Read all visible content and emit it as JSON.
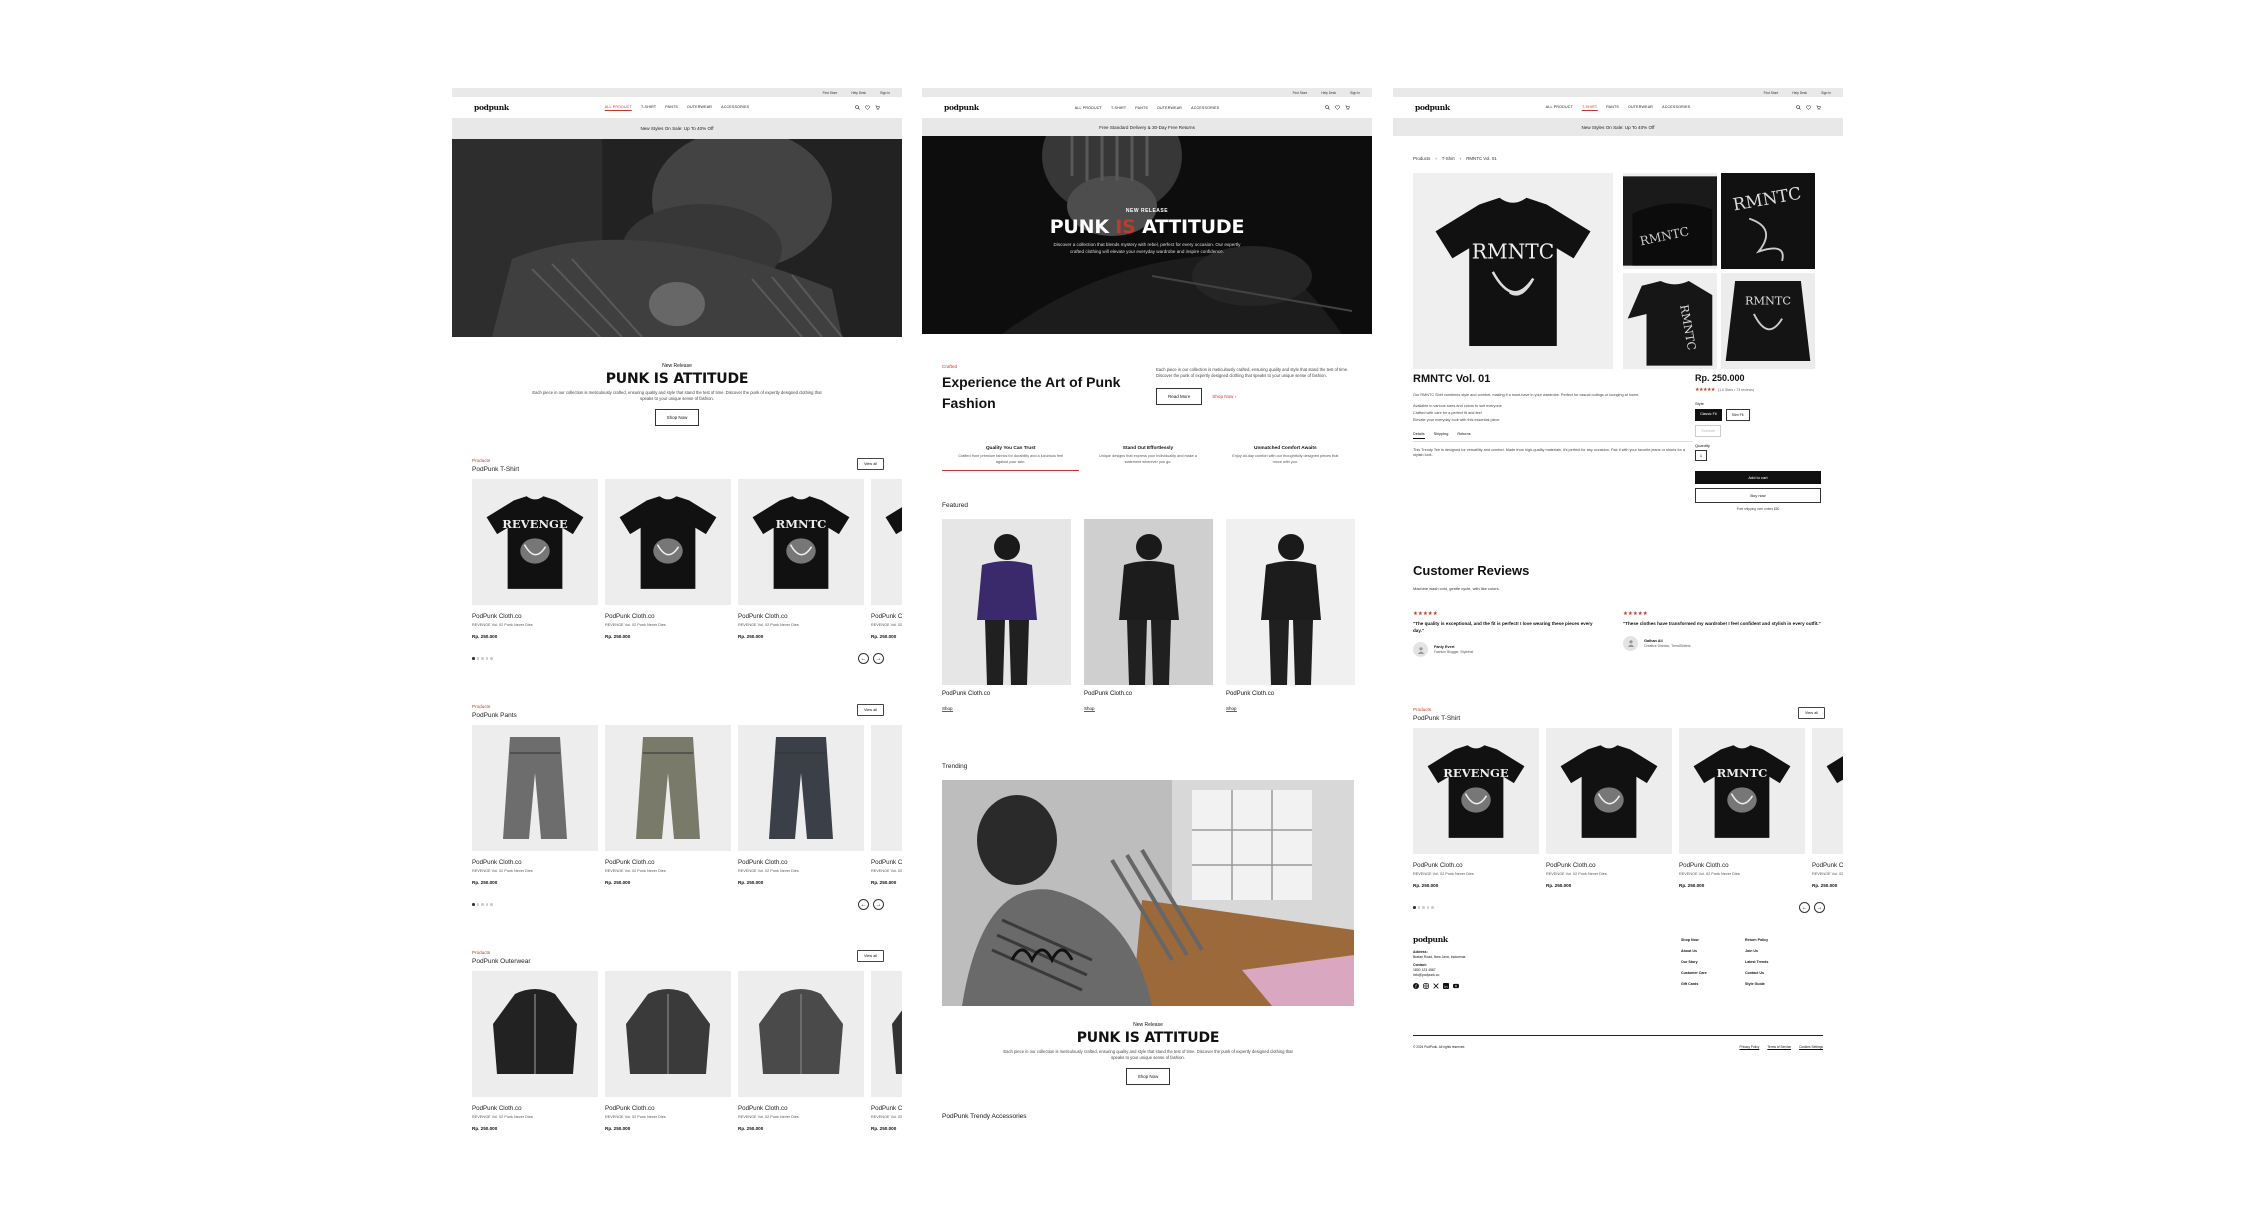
{
  "common": {
    "util": [
      "Find Store",
      "Help Desk",
      "Sign In"
    ],
    "logo": "podpunk",
    "menu": [
      "ALL PRODUCT",
      "T-SHIRT",
      "PANTS",
      "OUTERWEAR",
      "ACCESSORIES"
    ],
    "banner_sale": "New Styles On Sale: Up To 40% Off",
    "banner_delivery": "Free Standard Delivery & 30-Day Free Returns",
    "brand": "PodPunk Cloth.co",
    "product_sub": "REVENGE Vol. 02 Punk Never Dies",
    "price": "Rp. 250.000",
    "view_all": "View all",
    "products_tag": "Products"
  },
  "screen1": {
    "hero_tag": "New Release",
    "hero_title": "PUNK IS ATTITUDE",
    "hero_desc": "Each piece in our collection is meticulously crafted, ensuring quality and style that stand the test of time. Discover the punk of expertly designed clothing that speaks to your unique sense of fashion.",
    "shop_now": "Shop Now",
    "sections": [
      "PodPunk T-Shirt",
      "PodPunk Pants",
      "PodPunk Outerwear"
    ],
    "tee_prints": [
      "REVENGE",
      "",
      "RMNTC",
      ""
    ]
  },
  "screen2": {
    "hero_tag": "NEW RELEASE",
    "hero_title_a": "PUNK ",
    "hero_title_b": "IS",
    "hero_title_c": " ATTITUDE",
    "hero_desc": "Discover a collection that blends mystery with rebel, perfect for every occasion. Our expertly crafted clothing will elevate your everyday wardrobe and inspire confidence.",
    "crafted_tag": "Crafted",
    "crafted_title": "Experience the  Art of Punk Fashion",
    "crafted_desc": "Each piece in our collection is meticulously crafted, ensuring quality and style that stand the test of time. Discover the punk of expertly designed clothing that speaks to your unique sense of fashion.",
    "read_more": "Read More",
    "shop_now": "Shop Now",
    "features": [
      {
        "title": "Quality You Can Trust",
        "desc": "Crafted from premium fabrics for durability and a luxurious feel against your skin."
      },
      {
        "title": "Stand Out Effortlessly",
        "desc": "Unique designs that express your individuality and make a statement wherever you go."
      },
      {
        "title": "Unmatched Comfort Awaits",
        "desc": "Enjoy all-day comfort with our thoughtfully designed pieces that move with you."
      }
    ],
    "featured_label": "Featured",
    "featured_cards": [
      "PodPunk Cloth.co",
      "PodPunk Cloth.co",
      "PodPunk Cloth.co"
    ],
    "shop_link": "Shop",
    "trending_label": "Trending",
    "bottom_tag": "New Release",
    "bottom_title": "PUNK IS ATTITUDE",
    "bottom_desc": "Each piece in our collection is meticulously crafted, ensuring quality and style that stand the test of time. Discover the punk of expertly designed clothing that speaks to your unique sense of fashion.",
    "accessories_title": "PodPunk Trendy Accessories"
  },
  "screen3": {
    "breadcrumb": [
      "Products",
      "T-Shirt",
      "RMNTC Vol. 01"
    ],
    "product_title": "RMNTC Vol. 01",
    "price": "Rp. 250.000",
    "rating": "4.9",
    "reviews_count": "(1.6 Stars • 73 reviews)",
    "desc": "Our RMNTC Shirt combines style and comfort, making it a must-have in your wardrobe. Perfect for casual outings or lounging at home.",
    "bullets": [
      "Available in various sizes and colors to suit everyone",
      "Crafted with care for a perfect fit and feel",
      "Elevate your everyday look with this essential piece"
    ],
    "style_label": "Style",
    "styles": [
      "Classic Fit",
      "Slim Fit",
      "Oversize"
    ],
    "quantity_label": "Quantity",
    "quantity": "1",
    "tabs": [
      "Details",
      "Shipping",
      "Returns"
    ],
    "tab_text": "This Trendy Tee is designed for versatility and comfort. Made from high-quality materials, it's perfect for any occasion. Pair it with your favorite jeans or shorts for a stylish look.",
    "add_to_cart": "Add to cart",
    "buy_now": "Buy now",
    "free_shipping": "Free shipping over orders $50",
    "reviews_title": "Customer Reviews",
    "reviews_sub": "Machine wash cold, gentle cycle, with like colors.",
    "reviews": [
      {
        "quote": "\"The quality is exceptional, and the fit is perfect! I love wearing these pieces every day.\"",
        "name": "Fanly Evert",
        "role": "Fashion Blogger, Styleinst"
      },
      {
        "quote": "\"These clothes have transformed my wardrobe! I feel confident and stylish in every outfit.\"",
        "name": "Galhan Ali",
        "role": "Creative Director, TrendSetters"
      }
    ],
    "section_title": "PodPunk T-Shirt",
    "footer": {
      "address_label": "Address:",
      "address": "Bratan Road, New Java, Indonesia",
      "contact_label": "Contact:",
      "phone": "1800 123 4567",
      "email": "info@podpunk.co",
      "col1": [
        "Shop Now",
        "About Us",
        "Our Story",
        "Customer Care",
        "Gift Cards"
      ],
      "col2": [
        "Return Policy",
        "Join Us",
        "Latest Trends",
        "Contact Us",
        "Style Guide"
      ],
      "copyright": "© 2024 PodPunk. All rights reserved.",
      "legal": [
        "Privacy Policy",
        "Terms of Service",
        "Cookies Settings"
      ]
    }
  }
}
